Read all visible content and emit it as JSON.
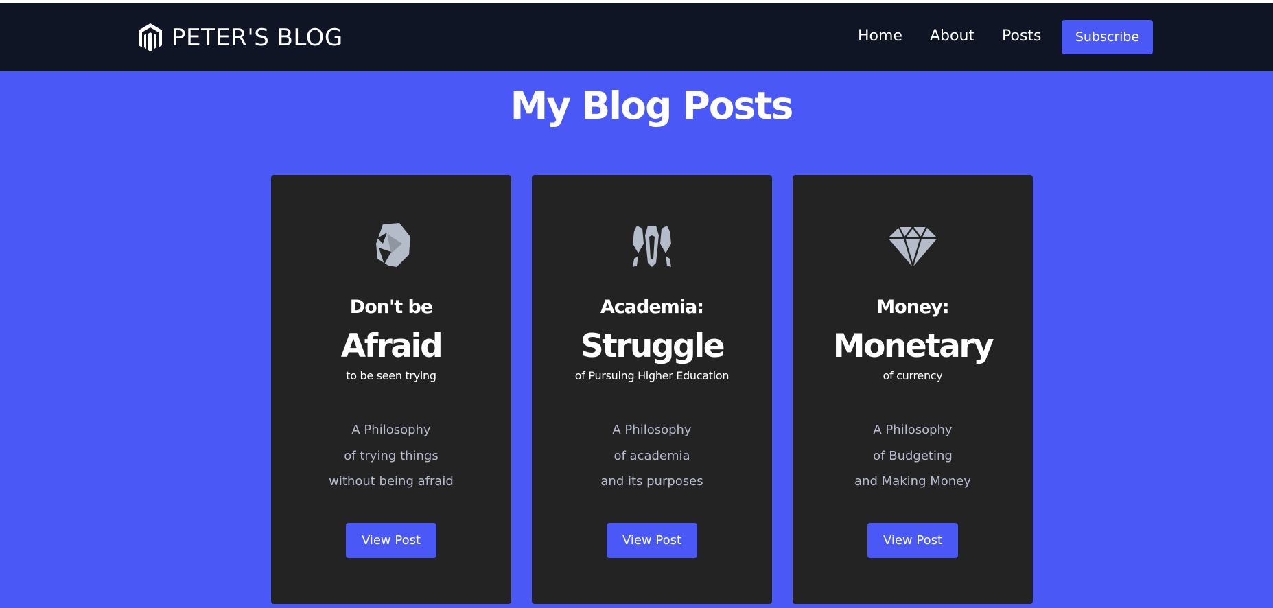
{
  "colors": {
    "page_background": "#4a58f6",
    "navbar_background": "#0f1524",
    "card_background": "#232323",
    "accent": "#4a58f6",
    "icon": "#b4bcc9",
    "muted_text": "#b7bccf"
  },
  "navbar": {
    "logo_icon": "magento-logo-icon",
    "brand": "PETER'S BLOG",
    "links": [
      "Home",
      "About",
      "Posts"
    ],
    "subscribe_label": "Subscribe"
  },
  "main": {
    "title": "My Blog Posts",
    "posts": [
      {
        "icon": "rock-icon",
        "kicker": "Don't be",
        "headline": "Afraid",
        "subtitle": "to be seen trying",
        "description": [
          "A Philosophy",
          "of trying things",
          "without being afraid"
        ],
        "button_label": "View Post"
      },
      {
        "icon": "crystals-icon",
        "kicker": "Academia:",
        "headline": "Struggle",
        "subtitle": "of Pursuing Higher Education",
        "description": [
          "A Philosophy",
          "of academia",
          "and its purposes"
        ],
        "button_label": "View Post"
      },
      {
        "icon": "diamond-icon",
        "kicker": "Money:",
        "headline": "Monetary",
        "subtitle": "of currency",
        "description": [
          "A Philosophy",
          "of Budgeting",
          "and Making Money"
        ],
        "button_label": "View Post"
      }
    ]
  }
}
